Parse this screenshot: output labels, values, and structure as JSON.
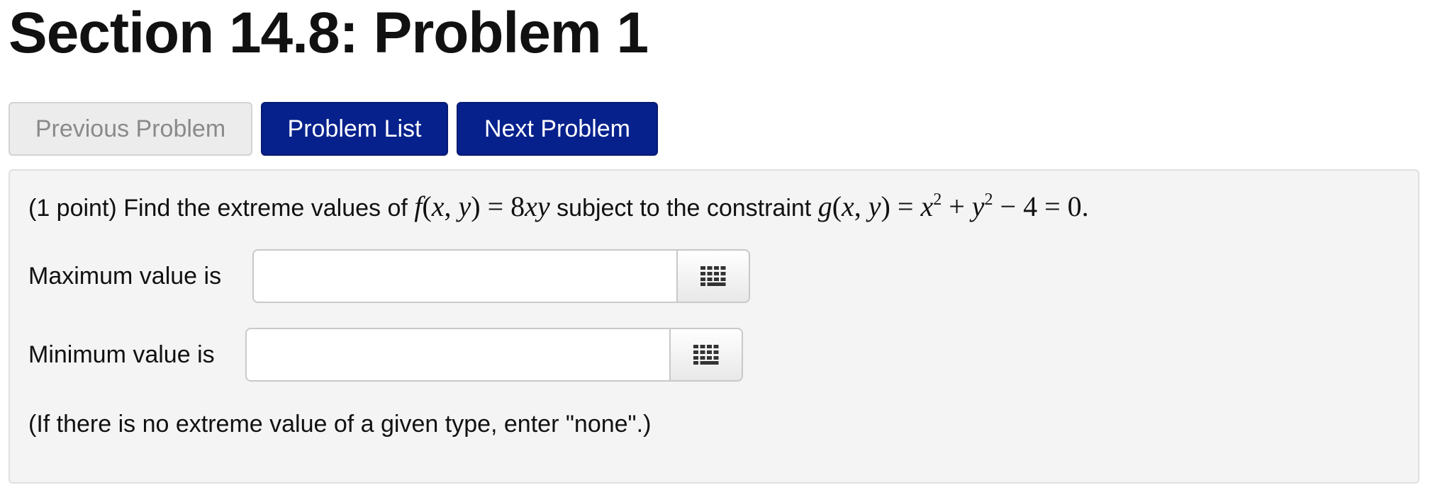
{
  "page": {
    "title": "Section 14.8: Problem 1"
  },
  "nav": {
    "previous_label": "Previous Problem",
    "list_label": "Problem List",
    "next_label": "Next Problem"
  },
  "problem": {
    "points": "(1 point)",
    "text_before_f": "Find the extreme values of",
    "text_between": "subject to the constraint",
    "f_expression": "f(x, y) = 8xy",
    "g_expression": "g(x, y) = x² + y² − 4 = 0.",
    "answers": [
      {
        "label": "Maximum value is",
        "value": "",
        "icon": "keypad-icon"
      },
      {
        "label": "Minimum value is",
        "value": "",
        "icon": "keypad-icon"
      }
    ],
    "note": "(If there is no extreme value of a given type, enter \"none\".)"
  },
  "colors": {
    "primary_button": "#06218c",
    "disabled_button": "#ececec",
    "panel_background": "#f4f4f4"
  }
}
